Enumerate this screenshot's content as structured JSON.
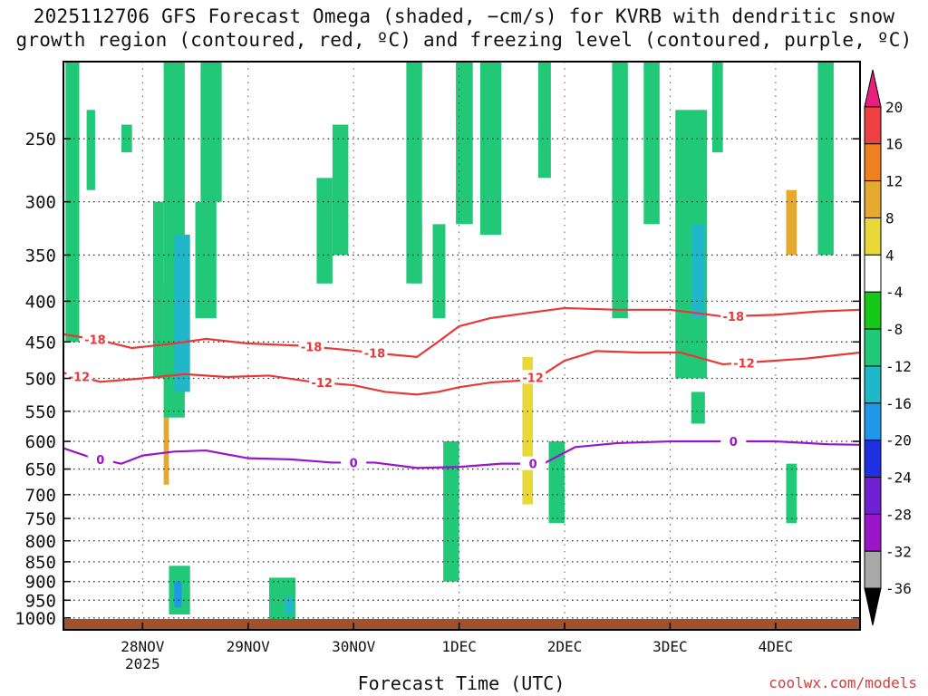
{
  "title_line1": "2025112706 GFS Forecast Omega (shaded, −cm/s) for KVRB with dendritic snow",
  "title_line2": "growth region (contoured, red, ºC) and freezing level (contoured, purple, ºC)",
  "credit": "coolwx.com/models",
  "chart_data": {
    "type": "heatmap",
    "title": "2025112706 GFS Forecast Omega (shaded, −cm/s) for KVRB with dendritic snow growth region (contoured, red, ºC) and freezing level (contoured, purple, ºC)",
    "xlabel": "Forecast Time (UTC)",
    "ylabel": "",
    "x_range_days": [
      0.25,
      7.8
    ],
    "x_ticks": [
      {
        "day": 1,
        "label": "28NOV",
        "sublabel": "2025"
      },
      {
        "day": 2,
        "label": "29NOV",
        "sublabel": ""
      },
      {
        "day": 3,
        "label": "30NOV",
        "sublabel": ""
      },
      {
        "day": 4,
        "label": "1DEC",
        "sublabel": ""
      },
      {
        "day": 5,
        "label": "2DEC",
        "sublabel": ""
      },
      {
        "day": 6,
        "label": "3DEC",
        "sublabel": ""
      },
      {
        "day": 7,
        "label": "4DEC",
        "sublabel": ""
      }
    ],
    "y_scale": "log-pressure (hPa), inverted",
    "y_range_hpa": [
      1035,
      200
    ],
    "y_ticks": [
      250,
      300,
      350,
      400,
      450,
      500,
      550,
      600,
      650,
      700,
      750,
      800,
      850,
      900,
      950,
      1000
    ],
    "grid": true,
    "colorbar": {
      "levels": [
        20,
        16,
        12,
        8,
        4,
        -4,
        -8,
        -12,
        -16,
        -20,
        -24,
        -28,
        -32,
        -36
      ],
      "labels": [
        "20",
        "16",
        "12",
        "8",
        "4",
        "-4",
        "-8",
        "-12",
        "-16",
        "-20",
        "-24",
        "-28",
        "-32",
        "-36"
      ],
      "colors": [
        "#e7207e",
        "#ee4040",
        "#ee8020",
        "#e5a830",
        "#e8d838",
        "#ffffff",
        "#18c818",
        "#20c878",
        "#20b8c8",
        "#2098e8",
        "#2030e0",
        "#7020d0",
        "#9a14c8",
        "#a8a8a8",
        "#000000"
      ]
    },
    "contours": [
      {
        "label": "-18",
        "color": "#e83838",
        "x": [
          0.25,
          0.6,
          0.9,
          1.3,
          1.6,
          2.0,
          2.5,
          2.9,
          3.3,
          3.6,
          3.8,
          4.0,
          4.3,
          4.7,
          5.0,
          5.5,
          6.0,
          6.5,
          7.0,
          7.4,
          7.8
        ],
        "y": [
          440,
          448,
          458,
          452,
          446,
          452,
          455,
          460,
          466,
          470,
          450,
          430,
          420,
          413,
          408,
          410,
          410,
          418,
          416,
          412,
          410
        ],
        "label_days": [
          0.55,
          2.6,
          3.2,
          6.6
        ]
      },
      {
        "label": "-12",
        "color": "#e83838",
        "x": [
          0.25,
          0.6,
          1.0,
          1.4,
          1.8,
          2.2,
          2.6,
          3.0,
          3.3,
          3.6,
          3.8,
          4.0,
          4.3,
          4.6,
          4.8,
          5.0,
          5.3,
          5.7,
          6.1,
          6.5,
          6.9,
          7.3,
          7.8
        ],
        "y": [
          492,
          505,
          500,
          494,
          498,
          496,
          505,
          510,
          520,
          524,
          520,
          513,
          506,
          503,
          494,
          475,
          462,
          464,
          464,
          480,
          476,
          472,
          464
        ],
        "label_days": [
          0.4,
          2.7,
          4.7,
          6.7
        ]
      },
      {
        "label": "0",
        "color": "#9a14c8",
        "x": [
          0.25,
          0.5,
          0.8,
          1.0,
          1.3,
          1.6,
          2.0,
          2.4,
          2.8,
          3.2,
          3.6,
          4.0,
          4.4,
          4.8,
          5.1,
          5.5,
          6.0,
          6.5,
          7.0,
          7.5,
          7.8
        ],
        "y": [
          612,
          628,
          640,
          625,
          618,
          616,
          630,
          632,
          638,
          638,
          648,
          646,
          640,
          640,
          610,
          603,
          600,
          600,
          600,
          605,
          606
        ],
        "label_days": [
          0.6,
          3.0,
          4.7,
          6.6
        ]
      }
    ],
    "regions": [
      {
        "shade": "4",
        "x": [
          0.25,
          0.45
        ],
        "p": [
          270,
          345
        ]
      },
      {
        "shade": "4",
        "x": [
          0.6,
          0.75
        ],
        "p": [
          265,
          310
        ]
      },
      {
        "shade": "4",
        "x": [
          0.6,
          0.72
        ],
        "p": [
          200,
          215
        ]
      },
      {
        "shade": "4",
        "x": [
          0.9,
          1.0
        ],
        "p": [
          320,
          820
        ]
      },
      {
        "shade": "12",
        "x": [
          0.95,
          1.0
        ],
        "p": [
          380,
          680
        ]
      },
      {
        "shade": "-8",
        "x": [
          0.02,
          0.15
        ],
        "p": [
          200,
          450
        ]
      },
      {
        "shade": "-8",
        "x": [
          0.22,
          0.3
        ],
        "p": [
          230,
          290
        ]
      },
      {
        "shade": "-8",
        "x": [
          0.55,
          0.65
        ],
        "p": [
          240,
          260
        ]
      },
      {
        "shade": "-8",
        "x": [
          0.85,
          0.95
        ],
        "p": [
          300,
          500
        ]
      },
      {
        "shade": "-8",
        "x": [
          0.95,
          1.15
        ],
        "p": [
          200,
          560
        ]
      },
      {
        "shade": "-12",
        "x": [
          1.05,
          1.2
        ],
        "p": [
          330,
          520
        ]
      },
      {
        "shade": "-8",
        "x": [
          1.3,
          1.5
        ],
        "p": [
          200,
          300
        ]
      },
      {
        "shade": "-8",
        "x": [
          1.25,
          1.45
        ],
        "p": [
          300,
          420
        ]
      },
      {
        "shade": "-8",
        "x": [
          1.0,
          1.2
        ],
        "p": [
          860,
          990
        ]
      },
      {
        "shade": "-16",
        "x": [
          1.05,
          1.12
        ],
        "p": [
          900,
          970
        ]
      },
      {
        "shade": "-8",
        "x": [
          1.95,
          2.2
        ],
        "p": [
          890,
          1005
        ]
      },
      {
        "shade": "-12",
        "x": [
          2.1,
          2.18
        ],
        "p": [
          940,
          990
        ]
      },
      {
        "shade": "4",
        "x": [
          2.05,
          2.2
        ],
        "p": [
          670,
          720
        ]
      },
      {
        "shade": "4",
        "x": [
          2.25,
          2.35
        ],
        "p": [
          820,
          860
        ]
      },
      {
        "shade": "4",
        "x": [
          2.45,
          2.55
        ],
        "p": [
          750,
          830
        ]
      },
      {
        "shade": "4",
        "x": [
          0.35,
          0.45
        ],
        "p": [
          400,
          420
        ]
      },
      {
        "shade": "-8",
        "x": [
          2.55,
          2.7
        ],
        "p": [
          240,
          350
        ]
      },
      {
        "shade": "-8",
        "x": [
          2.4,
          2.55
        ],
        "p": [
          280,
          380
        ]
      },
      {
        "shade": "4",
        "x": [
          2.75,
          2.85
        ],
        "p": [
          310,
          380
        ]
      },
      {
        "shade": "4",
        "x": [
          3.05,
          3.2
        ],
        "p": [
          220,
          330
        ]
      },
      {
        "shade": "-8",
        "x": [
          3.25,
          3.4
        ],
        "p": [
          200,
          380
        ]
      },
      {
        "shade": "4",
        "x": [
          3.1,
          3.3
        ],
        "p": [
          380,
          520
        ]
      },
      {
        "shade": "4",
        "x": [
          3.2,
          3.35
        ],
        "p": [
          620,
          980
        ]
      },
      {
        "shade": "-8",
        "x": [
          3.5,
          3.62
        ],
        "p": [
          320,
          420
        ]
      },
      {
        "shade": "4",
        "x": [
          3.4,
          3.6
        ],
        "p": [
          210,
          320
        ]
      },
      {
        "shade": "-8",
        "x": [
          3.6,
          3.75
        ],
        "p": [
          600,
          900
        ]
      },
      {
        "shade": "-8",
        "x": [
          3.72,
          3.88
        ],
        "p": [
          200,
          320
        ]
      },
      {
        "shade": "-12",
        "x": [
          3.98,
          4.08
        ],
        "p": [
          200,
          245
        ]
      },
      {
        "shade": "-8",
        "x": [
          3.95,
          4.15
        ],
        "p": [
          200,
          330
        ]
      },
      {
        "shade": "4",
        "x": [
          4.0,
          4.1
        ],
        "p": [
          480,
          620
        ]
      },
      {
        "shade": "4",
        "x": [
          4.15,
          4.25
        ],
        "p": [
          420,
          560
        ]
      },
      {
        "shade": "8",
        "x": [
          4.35,
          4.45
        ],
        "p": [
          470,
          720
        ]
      },
      {
        "shade": "-8",
        "x": [
          4.6,
          4.75
        ],
        "p": [
          600,
          760
        ]
      },
      {
        "shade": "-8",
        "x": [
          4.5,
          4.62
        ],
        "p": [
          200,
          280
        ]
      },
      {
        "shade": "4",
        "x": [
          4.75,
          4.85
        ],
        "p": [
          520,
          700
        ]
      },
      {
        "shade": "4",
        "x": [
          5.2,
          5.3
        ],
        "p": [
          650,
          800
        ]
      },
      {
        "shade": "-8",
        "x": [
          5.2,
          5.35
        ],
        "p": [
          200,
          420
        ]
      },
      {
        "shade": "-8",
        "x": [
          5.5,
          5.65
        ],
        "p": [
          200,
          320
        ]
      },
      {
        "shade": "4",
        "x": [
          5.75,
          5.85
        ],
        "p": [
          220,
          260
        ]
      },
      {
        "shade": "4",
        "x": [
          5.75,
          5.95
        ],
        "p": [
          760,
          880
        ]
      },
      {
        "shade": "-8",
        "x": [
          5.8,
          6.1
        ],
        "p": [
          230,
          500
        ]
      },
      {
        "shade": "-12",
        "x": [
          5.95,
          6.08
        ],
        "p": [
          320,
          420
        ]
      },
      {
        "shade": "-8",
        "x": [
          5.95,
          6.08
        ],
        "p": [
          520,
          570
        ]
      },
      {
        "shade": "4",
        "x": [
          6.1,
          6.25
        ],
        "p": [
          700,
          800
        ]
      },
      {
        "shade": "-8",
        "x": [
          6.15,
          6.25
        ],
        "p": [
          200,
          260
        ]
      },
      {
        "shade": "4",
        "x": [
          6.45,
          6.55
        ],
        "p": [
          395,
          490
        ]
      },
      {
        "shade": "4",
        "x": [
          6.8,
          7.0
        ],
        "p": [
          245,
          500
        ]
      },
      {
        "shade": "12",
        "x": [
          6.85,
          6.95
        ],
        "p": [
          290,
          350
        ]
      },
      {
        "shade": "-8",
        "x": [
          6.85,
          6.95
        ],
        "p": [
          640,
          760
        ]
      },
      {
        "shade": "4",
        "x": [
          7.0,
          7.1
        ],
        "p": [
          660,
          730
        ]
      },
      {
        "shade": "4",
        "x": [
          7.3,
          7.45
        ],
        "p": [
          220,
          370
        ]
      },
      {
        "shade": "-8",
        "x": [
          7.15,
          7.3
        ],
        "p": [
          200,
          350
        ]
      },
      {
        "shade": "-8",
        "x": [
          7.65,
          7.75
        ],
        "p": [
          220,
          245
        ]
      },
      {
        "shade": "4",
        "x": [
          7.6,
          7.7
        ],
        "p": [
          440,
          470
        ]
      },
      {
        "shade": "4",
        "x": [
          7.68,
          7.78
        ],
        "p": [
          760,
          810
        ]
      },
      {
        "shade": "-8",
        "x": [
          7.7,
          7.78
        ],
        "p": [
          920,
          970
        ]
      }
    ]
  }
}
